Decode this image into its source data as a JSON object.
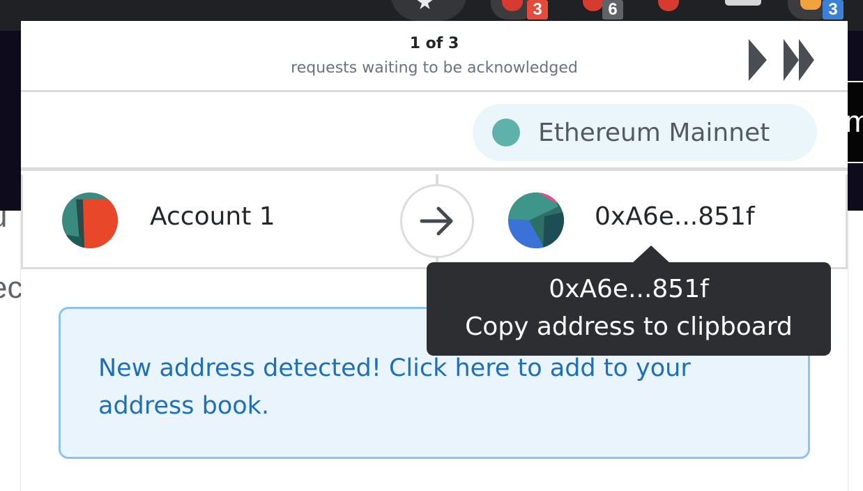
{
  "browser": {
    "extension_badges": [
      "3",
      "6",
      "3"
    ]
  },
  "background_page": {
    "right_glyph": "m",
    "left_glyphs": [
      "u",
      "ec"
    ]
  },
  "confirmation_queue": {
    "count_text": "1 of 3",
    "subtitle": "requests waiting to be acknowledged"
  },
  "network": {
    "name": "Ethereum Mainnet",
    "dot_color": "#5fb2aa"
  },
  "from_account": {
    "name": "Account 1"
  },
  "to_account": {
    "address": "0xA6e...851f"
  },
  "tooltip": {
    "address": "0xA6e...851f",
    "action": "Copy address to clipboard"
  },
  "notice": {
    "text": "New address detected! Click here to add to your address book."
  },
  "icons": {
    "next": "next-request-icon",
    "last": "last-request-icon",
    "arrow": "arrow-right-icon"
  },
  "colors": {
    "notice_text": "#1f6fb8",
    "notice_border": "#8ec2ee",
    "tooltip_bg": "#2d2e31"
  }
}
